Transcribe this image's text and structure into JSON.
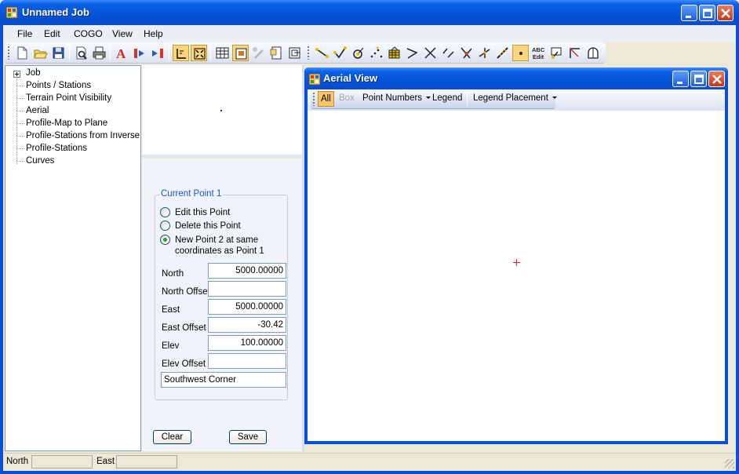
{
  "window": {
    "title": "Unnamed Job"
  },
  "menu": {
    "items": [
      "File",
      "Edit",
      "COGO",
      "View",
      "Help"
    ]
  },
  "toolbar": {
    "icons": [
      "new-icon",
      "open-icon",
      "save-icon",
      "print-preview-icon",
      "print-icon",
      "text-style-icon",
      "import-icon",
      "export-icon",
      "select-mode-icon",
      "zoom-extents-icon",
      "grid-icon",
      "layout-icon",
      "disabled-tool-icon",
      "properties-icon",
      "window-icon",
      "line-icon",
      "check-icon",
      "circle-point-icon",
      "dotted-points-icon",
      "building-icon",
      "bearing-icon",
      "cross-icon",
      "line-segments-icon",
      "intersect-icon",
      "offset-icon",
      "measure-icon",
      "point-square-icon",
      "text-edit-icon",
      "flag-icon",
      "angle-icon",
      "shape-icon"
    ],
    "text_edit_label_top": "ABC",
    "text_edit_label_bottom": "Edit"
  },
  "tree": {
    "root": "Job",
    "items": [
      "Points / Stations",
      "Terrain Point Visibility",
      "Aerial",
      "Profile-Map to Plane",
      "Profile-Stations from Inverse",
      "Profile-Stations",
      "Curves"
    ]
  },
  "point_panel": {
    "group_title": "Current Point 1",
    "options": [
      {
        "label": "Edit this Point",
        "checked": false
      },
      {
        "label": "Delete this Point",
        "checked": false
      },
      {
        "label": "New Point 2 at same",
        "label2": "coordinates as Point 1",
        "checked": true
      }
    ],
    "fields": {
      "north_label": "North",
      "north_value": "5000.00000",
      "north_offset_label": "North Offset",
      "north_offset_value": "",
      "east_label": "East",
      "east_value": "5000.00000",
      "east_offset_label": "East Offset",
      "east_offset_value": "-30.42",
      "elev_label": "Elev",
      "elev_value": "100.00000",
      "elev_offset_label": "Elev Offset",
      "elev_offset_value": "",
      "description_value": "Southwest Corner"
    },
    "clear_label": "Clear",
    "save_label": "Save"
  },
  "aerial": {
    "title": "Aerial View",
    "toolbar": {
      "all": "All",
      "box": "Box",
      "point_numbers": "Point Numbers",
      "legend": "Legend",
      "legend_placement": "Legend Placement"
    }
  },
  "statusbar": {
    "north_label": "North",
    "north_value": "",
    "east_label": "East",
    "east_value": ""
  },
  "colors": {
    "titlebar": "#0553d6",
    "accent_blue": "#1953d3",
    "checked": "#f9c56a",
    "marker": "#e0201a"
  }
}
